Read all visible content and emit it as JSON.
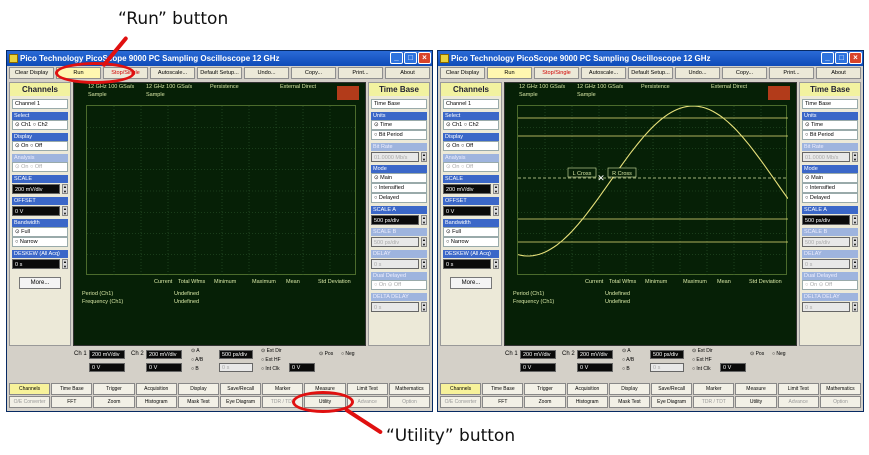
{
  "callouts": {
    "run": "“Run” button",
    "utility": "“Utility” button"
  },
  "colors": {
    "callout": "#e01010",
    "trace": "#e6e07a",
    "grid": "#2f5a2f",
    "panel_title_bg": "#f2f2a0",
    "active_tab": "#f7f29a"
  },
  "windows": [
    {
      "title": "Pico Technology   PicoScope 9000   PC Sampling Oscilloscope 12 GHz",
      "toolbar": [
        "Clear Display",
        "Run",
        "Stop/Single",
        "Autoscale...",
        "Default Setup...",
        "Undo...",
        "Copy...",
        "Print...",
        "About"
      ],
      "left_panel": {
        "title": "Channels",
        "channel": "Channel 1",
        "select_head": "Select",
        "select": "⊙ Ch1  ○ Ch2",
        "display_head": "Display",
        "display": "⊙ On   ○ Off",
        "analysis_head": "Analysis",
        "analysis": "⊙ On   ○ Off",
        "scale_head": "SCALE",
        "scale": "200 mV/div",
        "offset_head": "OFFSET",
        "offset": "0 V",
        "bandwidth_head": "Bandwidth",
        "bandwidth_a": "⊙ Full",
        "bandwidth_b": "○ Narrow",
        "deskew_head": "DESKEW (All Acq)",
        "deskew": "0 s",
        "more": "More..."
      },
      "right_panel": {
        "title": "Time Base",
        "timebase": "Time Base",
        "units_head": "Units",
        "units_a": "⊙ Time",
        "units_b": "○ Bit Period",
        "bitrate_head": "Bit Rate",
        "bitrate": "01.0000 Mb/s",
        "mode_head": "Mode",
        "mode_a": "⊙ Main",
        "mode_b": "○ Intensified",
        "mode_c": "○ Delayed",
        "scalea_head": "SCALE A",
        "scalea": "500 ps/div",
        "scaleb_head": "SCALE B",
        "scaleb": "500 ps/div",
        "delay_head": "DELAY",
        "delay": "0 s",
        "dual_head": "Dual Delayed",
        "dual": "○ On   ⊙ Off",
        "deltadelay_head": "DELTA DELAY",
        "deltadelay": "0 s"
      },
      "scope": {
        "h1": "12 GHz  100 GSa/s",
        "h1b": "Sample",
        "h2": "12 GHz  100 GSa/s",
        "h2b": "Sample",
        "h3": "Persistence",
        "h4": "External Direct",
        "marker_label": "",
        "lcross": "",
        "rcross": "",
        "show_trace": false,
        "meas_heads": [
          "Current",
          "Total Wfms",
          "Minimum",
          "Maximum",
          "Mean",
          "Std Deviation"
        ],
        "rows": [
          {
            "label": "Period (Ch1)",
            "value": "Undefined"
          },
          {
            "label": "Frequency (Ch1)",
            "value": "Undefined"
          }
        ]
      },
      "channel_row": {
        "ch1": "Ch 1",
        "ch1_val": "200 mV/div",
        "ch2": "Ch 2",
        "ch2_val": "200 mV/div",
        "off1": "0 V",
        "off2": "0 V",
        "a": "⊙ A",
        "ab": "○ A/B",
        "b": "○ B",
        "tb_val": "500 ps/div",
        "tb_off": "0 s",
        "extdir": "⊙ Ext Dir",
        "exthf": "○ Ext HF",
        "intclk": "○ Int Clk",
        "trig_val": "0 V",
        "pos": "⊙ Pos",
        "neg": "○ Neg"
      },
      "tabs_row1": [
        "Channels",
        "Time Base",
        "Trigger",
        "Acquisition",
        "Display",
        "Save/Recall",
        "Marker",
        "Measure",
        "Limit Test",
        "Mathematics"
      ],
      "tabs_row2": [
        "O/E Converter",
        "FFT",
        "Zoom",
        "Histogram",
        "Mask Test",
        "Eye Diagram",
        "TDR / TDT",
        "Utility",
        "Advance",
        "Option"
      ]
    },
    {
      "title": "Pico Technology   PicoScope 9000   PC Sampling Oscilloscope 12 GHz",
      "toolbar": [
        "Clear Display",
        "Run",
        "Stop/Single",
        "Autoscale...",
        "Default Setup...",
        "Undo...",
        "Copy...",
        "Print...",
        "About"
      ],
      "left_panel": {
        "title": "Channels",
        "channel": "Channel 1",
        "select_head": "Select",
        "select": "⊙ Ch1  ○ Ch2",
        "display_head": "Display",
        "display": "⊙ On   ○ Off",
        "analysis_head": "Analysis",
        "analysis": "⊙ On   ○ Off",
        "scale_head": "SCALE",
        "scale": "200 mV/div",
        "offset_head": "OFFSET",
        "offset": "0 V",
        "bandwidth_head": "Bandwidth",
        "bandwidth_a": "⊙ Full",
        "bandwidth_b": "○ Narrow",
        "deskew_head": "DESKEW (All Acq)",
        "deskew": "0 s",
        "more": "More..."
      },
      "right_panel": {
        "title": "Time Base",
        "timebase": "Time Base",
        "units_head": "Units",
        "units_a": "⊙ Time",
        "units_b": "○ Bit Period",
        "bitrate_head": "Bit Rate",
        "bitrate": "01.0000 Mb/s",
        "mode_head": "Mode",
        "mode_a": "⊙ Main",
        "mode_b": "○ Intensified",
        "mode_c": "○ Delayed",
        "scalea_head": "SCALE A",
        "scalea": "500 ps/div",
        "scaleb_head": "SCALE B",
        "scaleb": "500 ps/div",
        "delay_head": "DELAY",
        "delay": "0 s",
        "dual_head": "Dual Delayed",
        "dual": "○ On   ⊙ Off",
        "deltadelay_head": "DELTA DELAY",
        "deltadelay": "0 s"
      },
      "scope": {
        "h1": "12 GHz  100 GSa/s",
        "h1b": "Sample",
        "h2": "12 GHz  100 GSa/s",
        "h2b": "Sample",
        "h3": "Persistence",
        "h4": "External Direct",
        "marker_label": "Ch1",
        "lcross": "L Cross",
        "rcross": "R Cross",
        "show_trace": true,
        "meas_heads": [
          "Current",
          "Total Wfms",
          "Minimum",
          "Maximum",
          "Mean",
          "Std Deviation"
        ],
        "rows": [
          {
            "label": "Period (Ch1)",
            "value": "Undefined"
          },
          {
            "label": "Frequency (Ch1)",
            "value": "Undefined"
          }
        ]
      },
      "channel_row": {
        "ch1": "Ch 1",
        "ch1_val": "200 mV/div",
        "ch2": "Ch 2",
        "ch2_val": "200 mV/div",
        "off1": "0 V",
        "off2": "0 V",
        "a": "⊙ A",
        "ab": "○ A/B",
        "b": "○ B",
        "tb_val": "500 ps/div",
        "tb_off": "0 s",
        "extdir": "⊙ Ext Dir",
        "exthf": "○ Ext HF",
        "intclk": "○ Int Clk",
        "trig_val": "0 V",
        "pos": "⊙ Pos",
        "neg": "○ Neg"
      },
      "tabs_row1": [
        "Channels",
        "Time Base",
        "Trigger",
        "Acquisition",
        "Display",
        "Save/Recall",
        "Marker",
        "Measure",
        "Limit Test",
        "Mathematics"
      ],
      "tabs_row2": [
        "O/E Converter",
        "FFT",
        "Zoom",
        "Histogram",
        "Mask Test",
        "Eye Diagram",
        "TDR / TDT",
        "Utility",
        "Advance",
        "Option"
      ]
    }
  ]
}
